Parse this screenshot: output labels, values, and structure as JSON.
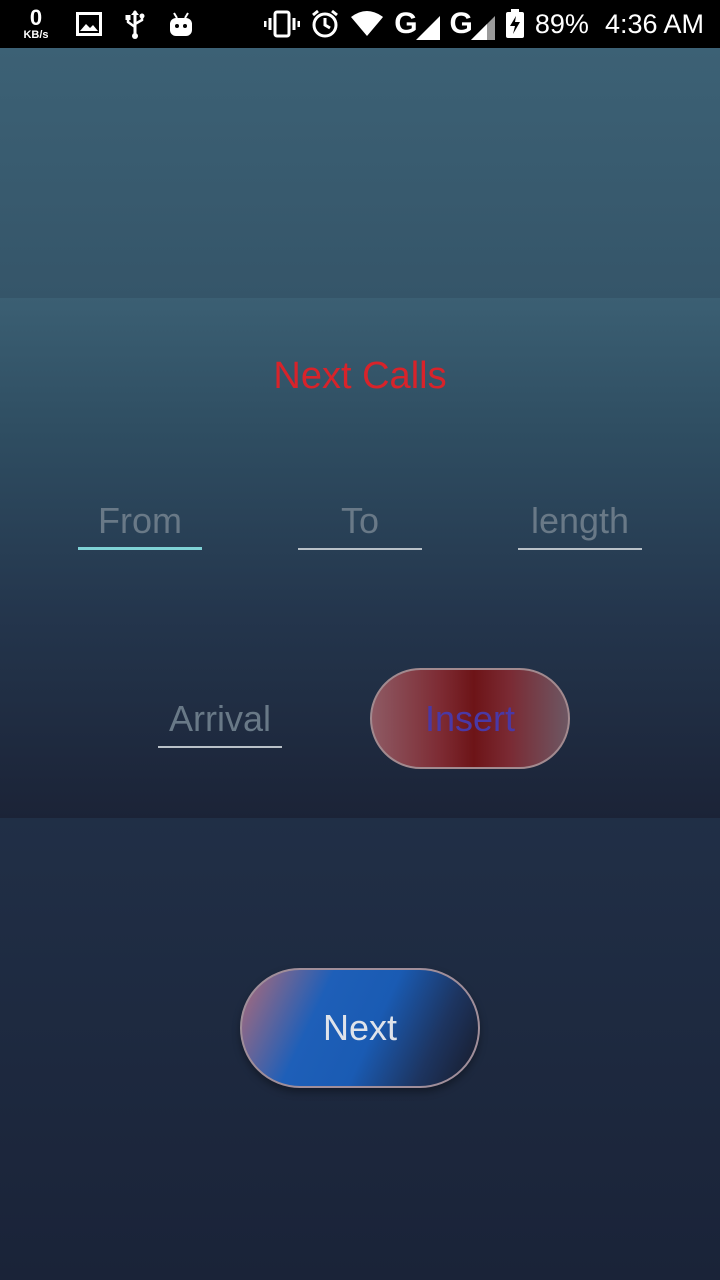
{
  "status_bar": {
    "net_speed_value": "0",
    "net_speed_unit": "KB/s",
    "network_left": "G",
    "network_right": "G",
    "battery_percent": "89%",
    "time": "4:36 AM",
    "icons": [
      "image-icon",
      "usb-icon",
      "android-icon",
      "vibrate-icon",
      "alarm-icon",
      "wifi-icon",
      "signal-icon",
      "signal-icon",
      "battery-charging-icon"
    ]
  },
  "dialog": {
    "title": "Next Calls",
    "title_color": "#d8232a",
    "fields": {
      "from_placeholder": "From",
      "to_placeholder": "To",
      "length_placeholder": "length",
      "arrival_placeholder": "Arrival"
    },
    "insert_label": "Insert"
  },
  "next_label": "Next",
  "colors": {
    "focus_underline": "#7fd2d6",
    "insert_text": "#4a38a6"
  }
}
